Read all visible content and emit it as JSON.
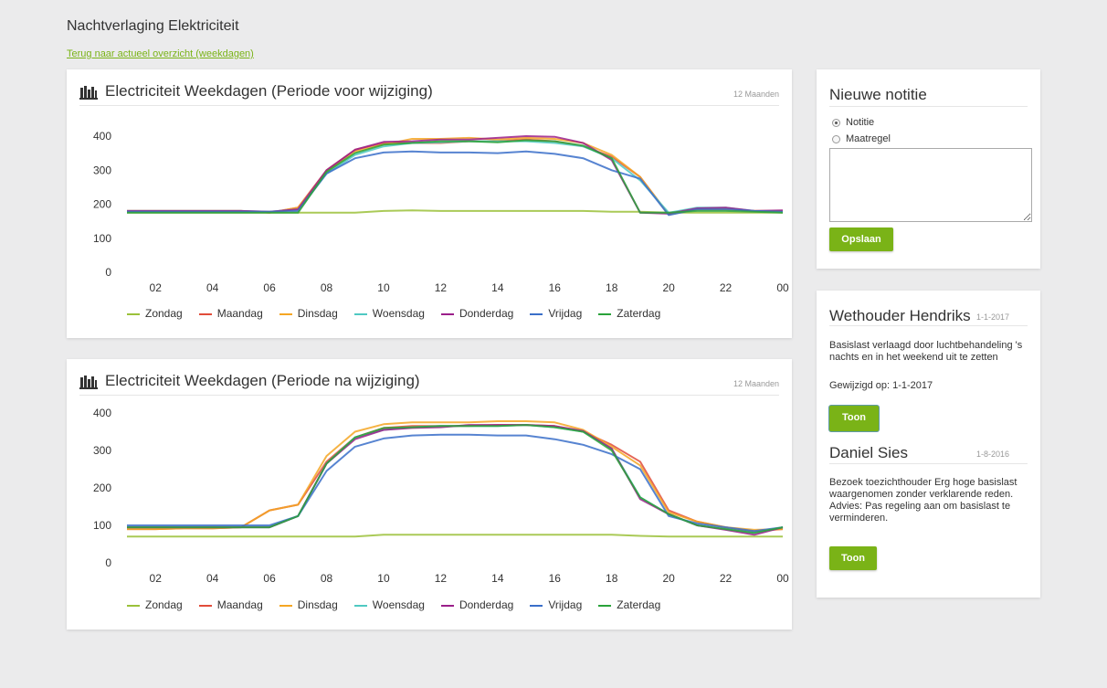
{
  "page": {
    "title": "Nachtverlaging Elektriciteit",
    "back_link": "Terug naar actueel overzicht (weekdagen)"
  },
  "charts": [
    {
      "title": "Electriciteit Weekdagen (Periode voor wijziging)",
      "period": "12 Maanden"
    },
    {
      "title": "Electriciteit Weekdagen (Periode na wijziging)",
      "period": "12 Maanden"
    }
  ],
  "chart_data": [
    {
      "type": "line",
      "title": "Electriciteit Weekdagen (Periode voor wijziging)",
      "x": [
        1,
        2,
        3,
        4,
        5,
        6,
        7,
        8,
        9,
        10,
        11,
        12,
        13,
        14,
        15,
        16,
        17,
        18,
        19,
        20,
        21,
        22,
        23,
        24
      ],
      "xticks": [
        "02",
        "04",
        "06",
        "08",
        "10",
        "12",
        "14",
        "16",
        "18",
        "20",
        "22",
        "00"
      ],
      "yticks": [
        0,
        100,
        200,
        300,
        400
      ],
      "ylim": [
        0,
        440
      ],
      "grid": false,
      "legend": "bottom",
      "series": [
        {
          "name": "Zondag",
          "color": "#9bc13a",
          "values": [
            175,
            175,
            175,
            175,
            175,
            175,
            175,
            175,
            175,
            180,
            182,
            180,
            180,
            180,
            180,
            180,
            180,
            178,
            178,
            175,
            175,
            175,
            175,
            175
          ]
        },
        {
          "name": "Maandag",
          "color": "#e14c3a",
          "values": [
            180,
            180,
            180,
            180,
            180,
            175,
            190,
            300,
            360,
            380,
            380,
            380,
            385,
            385,
            390,
            385,
            370,
            340,
            280,
            170,
            185,
            185,
            180,
            180
          ]
        },
        {
          "name": "Dinsdag",
          "color": "#f5a623",
          "values": [
            180,
            180,
            180,
            180,
            180,
            175,
            190,
            295,
            355,
            375,
            392,
            392,
            395,
            390,
            395,
            392,
            380,
            345,
            280,
            170,
            185,
            185,
            180,
            180
          ]
        },
        {
          "name": "Woensdag",
          "color": "#4fc9c2",
          "values": [
            180,
            180,
            180,
            180,
            180,
            178,
            185,
            290,
            345,
            370,
            380,
            382,
            385,
            385,
            385,
            380,
            370,
            335,
            270,
            175,
            190,
            190,
            180,
            178
          ]
        },
        {
          "name": "Donderdag",
          "color": "#9b1f8a",
          "values": [
            180,
            180,
            180,
            180,
            180,
            178,
            185,
            300,
            360,
            383,
            385,
            390,
            390,
            395,
            400,
            398,
            380,
            330,
            175,
            172,
            188,
            190,
            180,
            182
          ]
        },
        {
          "name": "Vrijdag",
          "color": "#3a6fc9",
          "values": [
            178,
            178,
            178,
            178,
            178,
            178,
            180,
            290,
            335,
            352,
            355,
            352,
            352,
            350,
            355,
            348,
            335,
            300,
            275,
            168,
            185,
            185,
            180,
            178
          ]
        },
        {
          "name": "Zaterdag",
          "color": "#2aa33a",
          "values": [
            175,
            175,
            175,
            175,
            175,
            175,
            175,
            295,
            350,
            375,
            380,
            385,
            385,
            382,
            388,
            385,
            372,
            335,
            175,
            175,
            180,
            180,
            178,
            175
          ]
        }
      ]
    },
    {
      "type": "line",
      "title": "Electriciteit Weekdagen (Periode na wijziging)",
      "x": [
        1,
        2,
        3,
        4,
        5,
        6,
        7,
        8,
        9,
        10,
        11,
        12,
        13,
        14,
        15,
        16,
        17,
        18,
        19,
        20,
        21,
        22,
        23,
        24
      ],
      "xticks": [
        "02",
        "04",
        "06",
        "08",
        "10",
        "12",
        "14",
        "16",
        "18",
        "20",
        "22",
        "00"
      ],
      "yticks": [
        0,
        100,
        200,
        300,
        400
      ],
      "ylim": [
        0,
        440
      ],
      "grid": false,
      "legend": "bottom",
      "series": [
        {
          "name": "Zondag",
          "color": "#9bc13a",
          "values": [
            70,
            70,
            70,
            70,
            70,
            70,
            70,
            70,
            70,
            75,
            75,
            75,
            75,
            75,
            75,
            75,
            75,
            75,
            72,
            70,
            70,
            70,
            70,
            70
          ]
        },
        {
          "name": "Maandag",
          "color": "#e14c3a",
          "values": [
            90,
            90,
            92,
            92,
            95,
            140,
            155,
            270,
            335,
            360,
            365,
            365,
            365,
            368,
            368,
            365,
            350,
            315,
            270,
            140,
            110,
            95,
            85,
            90
          ]
        },
        {
          "name": "Dinsdag",
          "color": "#f5a623",
          "values": [
            90,
            90,
            92,
            92,
            95,
            140,
            155,
            285,
            350,
            370,
            375,
            375,
            375,
            378,
            378,
            375,
            355,
            310,
            260,
            135,
            110,
            95,
            88,
            90
          ]
        },
        {
          "name": "Woensdag",
          "color": "#4fc9c2",
          "values": [
            95,
            95,
            95,
            95,
            95,
            95,
            125,
            265,
            335,
            355,
            362,
            365,
            365,
            365,
            368,
            362,
            350,
            305,
            175,
            130,
            100,
            90,
            80,
            95
          ]
        },
        {
          "name": "Donderdag",
          "color": "#9b1f8a",
          "values": [
            95,
            95,
            95,
            95,
            95,
            95,
            125,
            265,
            330,
            355,
            360,
            362,
            368,
            368,
            368,
            365,
            352,
            305,
            170,
            130,
            100,
            88,
            75,
            95
          ]
        },
        {
          "name": "Vrijdag",
          "color": "#3a6fc9",
          "values": [
            100,
            100,
            100,
            100,
            100,
            100,
            125,
            245,
            310,
            332,
            340,
            342,
            342,
            340,
            340,
            330,
            315,
            290,
            250,
            125,
            105,
            95,
            85,
            95
          ]
        },
        {
          "name": "Zaterdag",
          "color": "#2aa33a",
          "values": [
            95,
            95,
            95,
            95,
            95,
            95,
            125,
            265,
            335,
            360,
            362,
            365,
            365,
            365,
            368,
            362,
            350,
            300,
            175,
            130,
            100,
            90,
            80,
            95
          ]
        }
      ]
    }
  ],
  "note": {
    "title": "Nieuwe notitie",
    "radio_note": "Notitie",
    "radio_measure": "Maatregel",
    "textarea_value": "",
    "save_label": "Opslaan"
  },
  "measures": [
    {
      "title": "Wethouder Hendriks",
      "date": "1-1-2017",
      "text": "Basislast verlaagd door luchtbehandeling 's nachts en in het weekend uit te zetten",
      "modified": "Gewijzigd op: 1-1-2017",
      "button": "Toon"
    },
    {
      "title": "Daniel Sies",
      "date": "1-8-2016",
      "text": "Bezoek toezichthouder Erg hoge basislast waargenomen zonder verklarende reden. Advies: Pas regeling aan om basislast te verminderen.",
      "button": "Toon"
    }
  ],
  "colors": {
    "accent": "#7ab317",
    "background": "#ebebec"
  }
}
